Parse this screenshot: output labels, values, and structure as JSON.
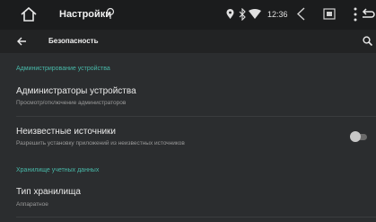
{
  "status_bar": {
    "app_name": "Настройки",
    "time": "12:36",
    "icons": [
      "home-icon",
      "pin-icon",
      "location-icon",
      "bluetooth-icon",
      "wifi-icon",
      "volume-icon",
      "window-icon",
      "more-vert-icon",
      "back-arrow-icon"
    ]
  },
  "toolbar": {
    "title": "Безопасность",
    "icons": [
      "arrow-back-icon",
      "search-icon"
    ]
  },
  "sections": [
    {
      "header": "Администрирование устройства",
      "items": [
        {
          "title": "Администраторы устройства",
          "subtitle": "Просмотр/отключение администраторов"
        },
        {
          "title": "Неизвестные источники",
          "subtitle": "Разрешить установку приложений из неизвестных источников",
          "toggle": false
        }
      ]
    },
    {
      "header": "Хранилище учетных данных",
      "items": [
        {
          "title": "Тип хранилища",
          "subtitle": "Аппаратное"
        }
      ]
    }
  ],
  "colors": {
    "accent": "#48b8a8",
    "background": "#2b2d2f",
    "statusbar": "#1b1c1d"
  }
}
